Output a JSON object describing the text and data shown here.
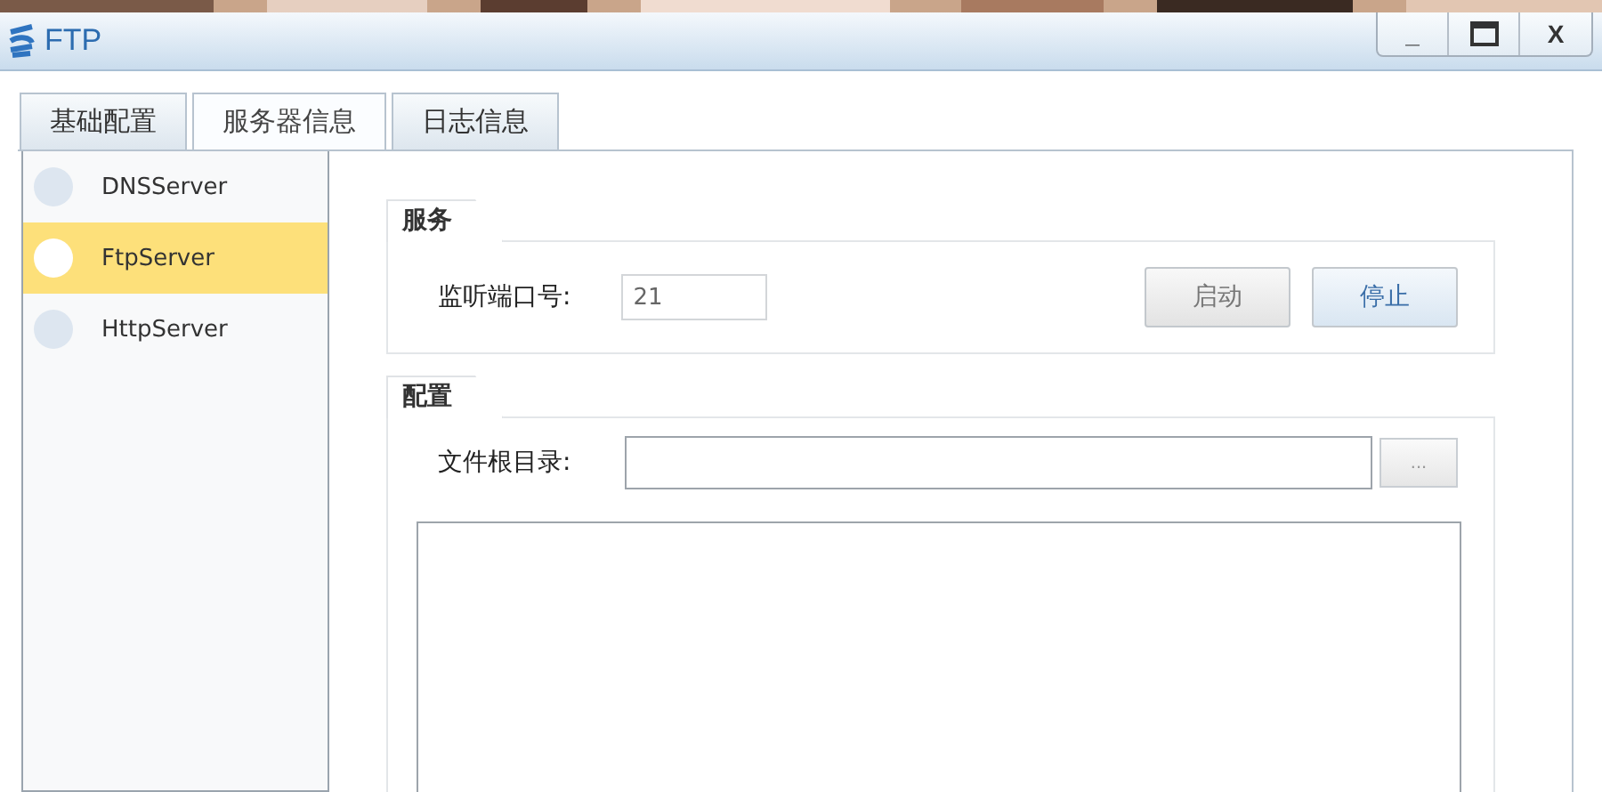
{
  "window": {
    "title": "FTP",
    "controls": [
      "_",
      "X"
    ]
  },
  "tabs": [
    {
      "label": "基础配置",
      "selected": false
    },
    {
      "label": "服务器信息",
      "selected": true
    },
    {
      "label": "日志信息",
      "selected": false
    }
  ],
  "servers": [
    {
      "name": "DNSServer",
      "selected": false
    },
    {
      "name": "FtpServer",
      "selected": true
    },
    {
      "name": "HttpServer",
      "selected": false
    }
  ],
  "service": {
    "title": "服务",
    "port_label": "监听端口号:",
    "port_value": "21",
    "buttons": [
      {
        "label": "启动",
        "kind": "start"
      },
      {
        "label": "停止",
        "kind": "stop"
      }
    ]
  },
  "config": {
    "title": "配置",
    "root_label": "文件根目录:",
    "browse": "..."
  }
}
